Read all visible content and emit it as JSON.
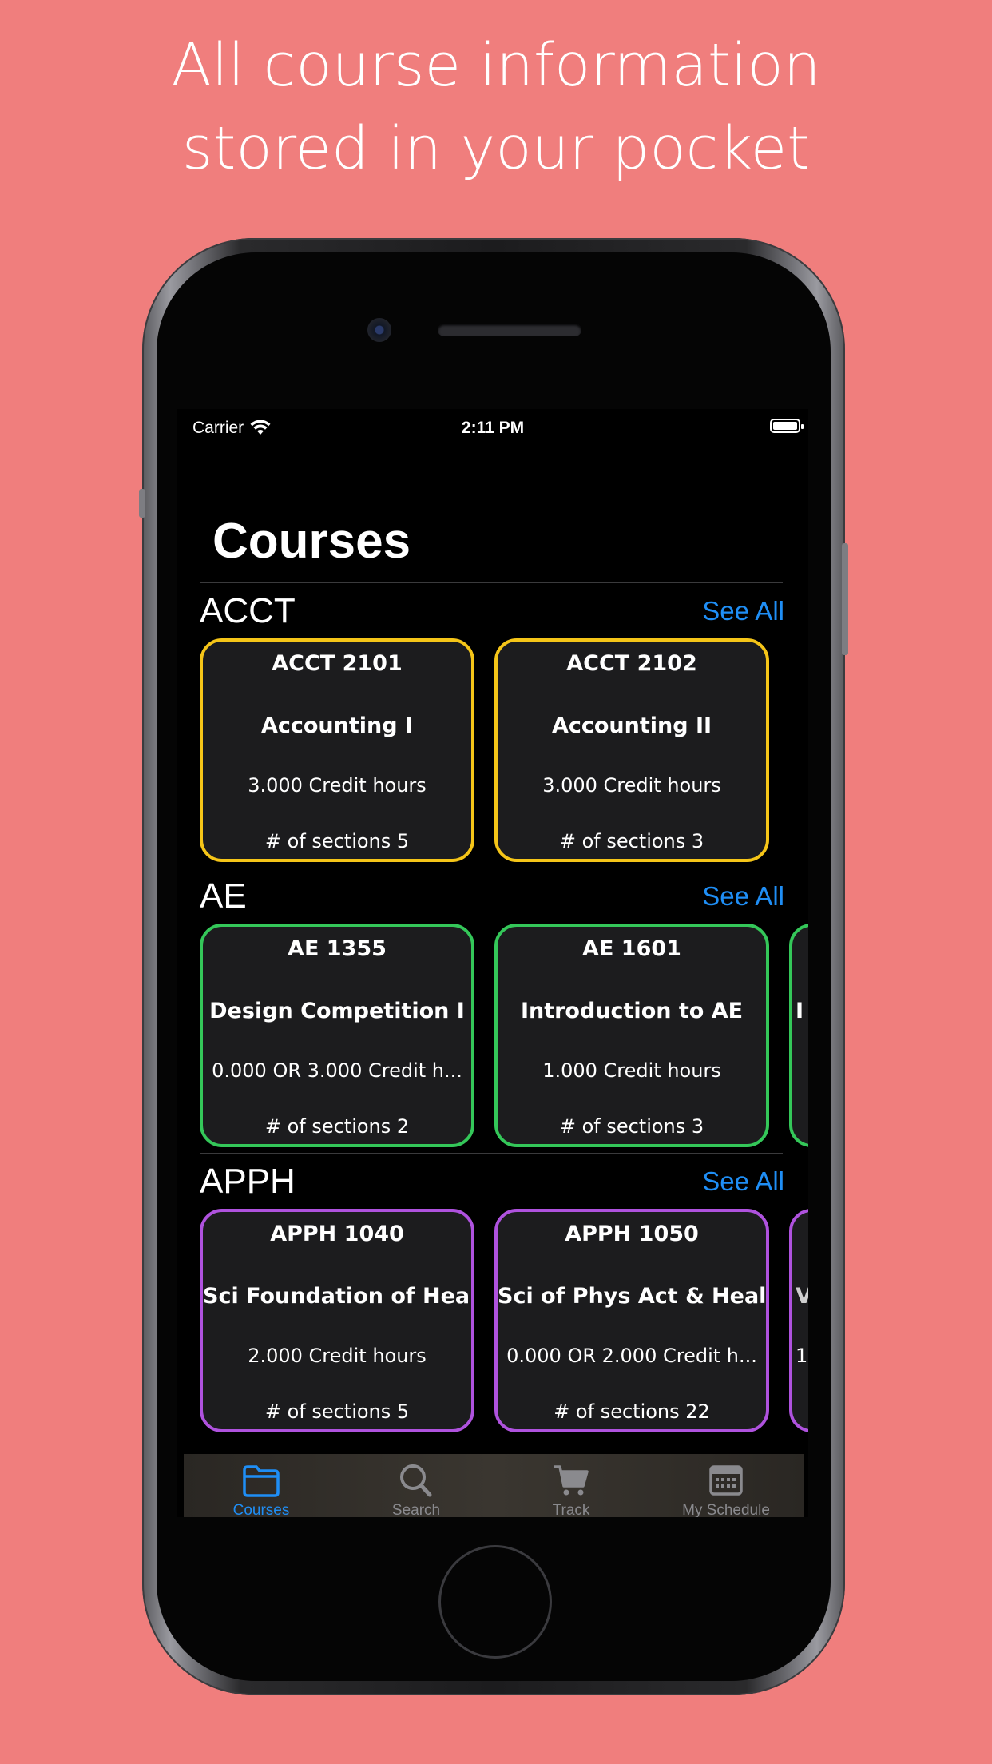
{
  "headline": [
    "All course information",
    "stored in your pocket"
  ],
  "status_bar": {
    "carrier": "Carrier",
    "time": "2:11 PM"
  },
  "page_title": "Courses",
  "see_all_label": "See All",
  "sections": [
    {
      "name": "ACCT",
      "accent": "#f5c518",
      "courses": [
        {
          "code": "ACCT 2101",
          "title": "Accounting I",
          "credits": "3.000 Credit hours",
          "sections": "# of sections 5"
        },
        {
          "code": "ACCT 2102",
          "title": "Accounting II",
          "credits": "3.000 Credit hours",
          "sections": "# of sections 3"
        }
      ]
    },
    {
      "name": "AE",
      "accent": "#34c759",
      "courses": [
        {
          "code": "AE 1355",
          "title": "Design Competition I",
          "credits": "0.000 OR 3.000 Credit h...",
          "sections": "# of sections 2"
        },
        {
          "code": "AE 1601",
          "title": "Introduction to AE",
          "credits": "1.000 Credit hours",
          "sections": "# of sections 3"
        },
        {
          "code": "",
          "title": "I",
          "credits": "",
          "sections": ""
        }
      ]
    },
    {
      "name": "APPH",
      "accent": "#af52de",
      "courses": [
        {
          "code": "APPH 1040",
          "title": "Sci Foundation of Health",
          "credits": "2.000 Credit hours",
          "sections": "# of sections 5"
        },
        {
          "code": "APPH 1050",
          "title": "Sci of Phys Act & Health",
          "credits": "0.000 OR 2.000 Credit h...",
          "sections": "# of sections 22"
        },
        {
          "code": "",
          "title": "V",
          "credits": "1",
          "sections": ""
        }
      ]
    }
  ],
  "tabs": [
    {
      "label": "Courses",
      "icon": "folder-icon",
      "active": true
    },
    {
      "label": "Search",
      "icon": "search-icon",
      "active": false
    },
    {
      "label": "Track",
      "icon": "cart-icon",
      "active": false
    },
    {
      "label": "My Schedule",
      "icon": "calendar-icon",
      "active": false
    }
  ],
  "colors": {
    "background": "#f07e7d",
    "link": "#1f8ef5",
    "card_bg": "#1c1c1e"
  }
}
